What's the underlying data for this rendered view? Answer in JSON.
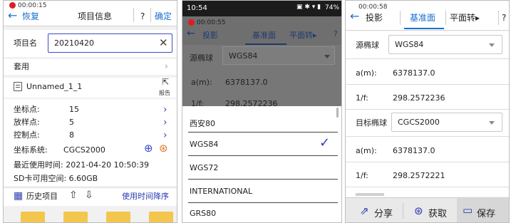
{
  "panel1": {
    "rec_time": "00:00:15",
    "back_label": "恢复",
    "title": "项目信息",
    "help": "?",
    "confirm": "确定",
    "name_label": "项目名",
    "name_value": "20210420",
    "apply_label": "套用",
    "file_name": "Unnamed_1_1",
    "report_label": "报告",
    "rows": [
      {
        "label": "坐标点:",
        "value": "15"
      },
      {
        "label": "放样点:",
        "value": "5"
      },
      {
        "label": "控制点:",
        "value": "8"
      }
    ],
    "cs_label": "坐标系统:",
    "cs_value": "CGCS2000",
    "last_used": "最近使用时间:   2021-04-20 10:50:39",
    "sd_space": "SD卡可用空间:  6.60GB",
    "history": "历史项目",
    "sort": "使用时间降序"
  },
  "panel2": {
    "status_time": "10:54",
    "status_right": "74%",
    "rec_time": "00:00:55",
    "tabs": [
      "投影",
      "基准面",
      "平面转▸",
      "?"
    ],
    "source_label": "源椭球",
    "source_value": "WGS84",
    "a_label": "a(m):",
    "a_value": "6378137.0",
    "f_label": "1/f:",
    "f_value": "298.2572236",
    "options": [
      "西安80",
      "WGS84",
      "WGS72",
      "INTERNATIONAL",
      "GRS80"
    ],
    "selected": "WGS84"
  },
  "panel3": {
    "rec_time": "00:00:58",
    "tabs": [
      "投影",
      "基准面",
      "平面转▸",
      "?"
    ],
    "source_label": "源椭球",
    "source_value": "WGS84",
    "a1_label": "a(m):",
    "a1_value": "6378137.0",
    "f1_label": "1/f:",
    "f1_value": "298.2572236",
    "target_label": "目标椭球",
    "target_value": "CGCS2000",
    "a2_label": "a(m):",
    "a2_value": "6378137.0",
    "f2_label": "1/f:",
    "f2_value": "298.2572221",
    "share": "分享",
    "fetch": "获取",
    "save": "保存"
  },
  "colors": {
    "accent": "#1a6fd0",
    "record": "#e01b24",
    "selected_check": "#2a3bb0"
  }
}
